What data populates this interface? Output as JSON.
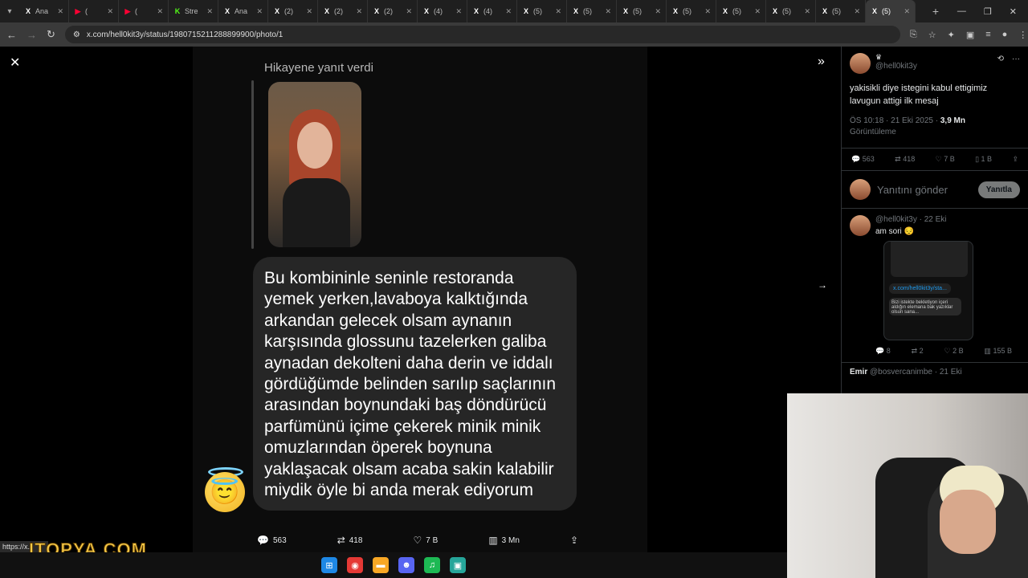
{
  "browser": {
    "tabs": [
      {
        "label": "Ana",
        "icon": "x-icon"
      },
      {
        "label": "(",
        "icon": "youtube-icon"
      },
      {
        "label": "(",
        "icon": "youtube-icon"
      },
      {
        "label": "Stre",
        "icon": "kick-icon"
      },
      {
        "label": "Ana",
        "icon": "x-icon"
      },
      {
        "label": "(2)",
        "icon": "x-icon"
      },
      {
        "label": "(2)",
        "icon": "x-icon"
      },
      {
        "label": "(2)",
        "icon": "x-icon"
      },
      {
        "label": "(4)",
        "icon": "x-icon"
      },
      {
        "label": "(4)",
        "icon": "x-icon"
      },
      {
        "label": "(5)",
        "icon": "x-icon"
      },
      {
        "label": "(5)",
        "icon": "x-icon"
      },
      {
        "label": "(5)",
        "icon": "x-icon"
      },
      {
        "label": "(5)",
        "icon": "x-icon"
      },
      {
        "label": "(5)",
        "icon": "x-icon"
      },
      {
        "label": "(5)",
        "icon": "x-icon"
      },
      {
        "label": "(5)",
        "icon": "x-icon"
      },
      {
        "label": "(5)",
        "icon": "x-icon",
        "active": true
      }
    ],
    "url": "x.com/hell0kit3y/status/1980715211288899900/photo/1",
    "status_url": "https://x."
  },
  "viewer": {
    "story_label": "Hikayene yanıt verdi",
    "message": "Bu kombininle seninle restoranda yemek yerken,lavaboya kalktığında arkandan gelecek olsam aynanın karşısında glossunu tazelerken galiba aynadan dekolteni daha derin ve iddalı gördüğümde belinden sarılıp saçlarının arasından boynundaki baş döndürücü parfümünü içime çekerek minik minik omuzlarından öperek boynuna yaklaşacak olsam acaba sakin kalabilir miydik öyle bi anda merak ediyorum",
    "actions": {
      "replies": "563",
      "reposts": "418",
      "likes": "7 B",
      "views": "3 Mn"
    }
  },
  "sidebar": {
    "author_handle": "@hell0kit3y",
    "tweet_text": "yakisikli diye istegini kabul ettigimiz lavugun attigi ilk mesaj",
    "meta_time": "ÖS 10:18 · 21 Eki 2025 ·",
    "meta_views": "3,9 Mn",
    "meta_views_label": "Görüntüleme",
    "stats": {
      "replies": "563",
      "reposts": "418",
      "likes": "7 B",
      "bookmarks": "1 B"
    },
    "reply_placeholder": "Yanıtını gönder",
    "reply_button": "Yanıtla",
    "reply1": {
      "header": "@hell0kit3y · 22 Eki",
      "text": "am sori 😔",
      "link": "x.com/hell0kit3y/sta...",
      "quote": "Bizi istekte bekletiyon içeri aldığın elemana bak yazıklar olsun sana...",
      "stats": {
        "replies": "8",
        "reposts": "2",
        "likes": "2 B",
        "views": "155 B"
      }
    },
    "reply2": {
      "name": "Emir",
      "handle": "@bosvercanimbe · 21 Eki"
    }
  },
  "overlay_logo": "ITOPYA.COM",
  "colors": {
    "accent": "#1d9bf0",
    "bubble": "#262626",
    "background": "#000000"
  }
}
